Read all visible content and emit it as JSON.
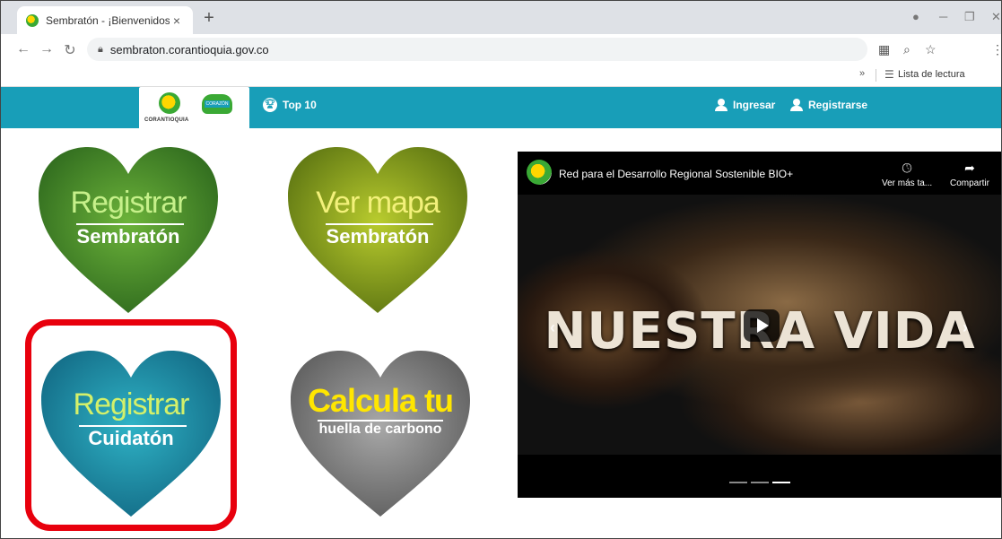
{
  "browser": {
    "tab_title": "Sembratón - ¡Bienvenidos!",
    "tab_close": "×",
    "new_tab": "+",
    "url": "sembraton.corantioquia.gov.co",
    "bookmarks_more": "»",
    "reading_list": "Lista de lectura",
    "icons": [
      "back-icon",
      "forward-icon",
      "reload-icon",
      "lock-icon",
      "qr-icon",
      "zoom-icon",
      "star-icon",
      "menu-icon"
    ]
  },
  "site": {
    "logo_brand": "CORANTIOQUIA",
    "logo_heart_text": "CORAZÓN",
    "nav": {
      "top10": "Top 10",
      "login": "Ingresar",
      "register": "Registrarse"
    },
    "hearts": [
      {
        "line1": "Registrar",
        "line2": "Sembratón",
        "color": "#3e8a2a"
      },
      {
        "line1": "Ver mapa",
        "line2": "Sembratón",
        "color": "#8aa21e"
      },
      {
        "line1": "Registrar",
        "line2": "Cuidatón",
        "color": "#148aa0"
      },
      {
        "line1": "Calcula tu",
        "line2": "huella de carbono",
        "color": "#7d7d7d"
      }
    ],
    "highlight_color": "#e8000d",
    "brand_color": "#189eb8"
  },
  "video": {
    "title": "Red para el Desarrollo Regional Sostenible BIO+",
    "watch_later": "Ver más ta...",
    "share": "Compartir",
    "overlay_text": "NUESTRA VIDA"
  }
}
